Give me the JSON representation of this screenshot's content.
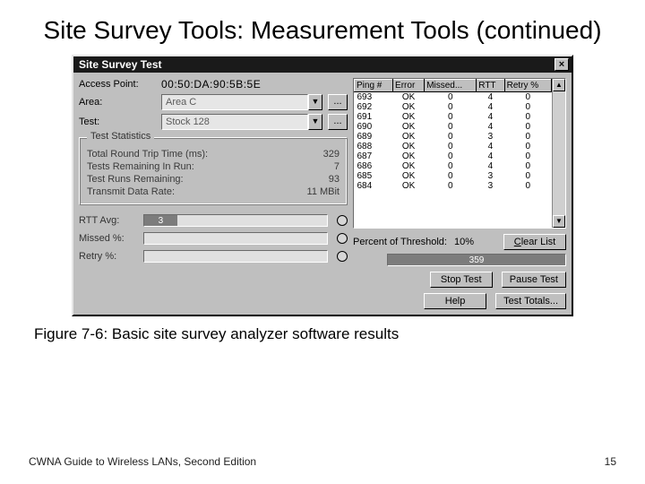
{
  "slide": {
    "title": "Site Survey Tools: Measurement Tools (continued)",
    "caption": "Figure 7-6: Basic site survey analyzer software results",
    "footer_left": "CWNA Guide to Wireless LANs, Second Edition",
    "footer_right": "15"
  },
  "window": {
    "title": "Site Survey Test",
    "close": "×",
    "labels": {
      "access_point": "Access Point:",
      "area": "Area:",
      "test": "Test:",
      "dots": "..."
    },
    "values": {
      "access_point": "00:50:DA:90:5B:5E",
      "area": "Area C",
      "test": "Stock 128"
    },
    "group": {
      "legend": "Test Statistics",
      "rows": [
        {
          "label": "Total Round Trip Time (ms):",
          "value": "329"
        },
        {
          "label": "Tests Remaining In Run:",
          "value": "7"
        },
        {
          "label": "Test Runs Remaining:",
          "value": "93"
        },
        {
          "label": "Transmit Data Rate:",
          "value": "11 MBit"
        }
      ]
    },
    "bars": {
      "rtt": {
        "label": "RTT Avg:",
        "value": "3"
      },
      "missed": {
        "label": "Missed %:",
        "value": ""
      },
      "retry": {
        "label": "Retry %:",
        "value": ""
      }
    },
    "grid": {
      "headers": [
        "Ping #",
        "Error",
        "Missed...",
        "RTT",
        "Retry %"
      ],
      "rows": [
        {
          "c": [
            "693",
            "OK",
            "0",
            "4",
            "0"
          ]
        },
        {
          "c": [
            "692",
            "OK",
            "0",
            "4",
            "0"
          ]
        },
        {
          "c": [
            "691",
            "OK",
            "0",
            "4",
            "0"
          ]
        },
        {
          "c": [
            "690",
            "OK",
            "0",
            "4",
            "0"
          ]
        },
        {
          "c": [
            "689",
            "OK",
            "0",
            "3",
            "0"
          ]
        },
        {
          "c": [
            "688",
            "OK",
            "0",
            "4",
            "0"
          ]
        },
        {
          "c": [
            "687",
            "OK",
            "0",
            "4",
            "0"
          ]
        },
        {
          "c": [
            "686",
            "OK",
            "0",
            "4",
            "0"
          ]
        },
        {
          "c": [
            "685",
            "OK",
            "0",
            "3",
            "0"
          ]
        },
        {
          "c": [
            "684",
            "OK",
            "0",
            "3",
            "0"
          ]
        }
      ],
      "scroll_up": "▲",
      "scroll_down": "▼"
    },
    "threshold": {
      "label": "Percent of Threshold:",
      "value": "10%"
    },
    "progress_value": "359",
    "buttons": {
      "clear_list": "Clear List",
      "stop_test": "Stop Test",
      "pause_test": "Pause Test",
      "help": "Help",
      "test_totals": "Test Totals..."
    }
  }
}
